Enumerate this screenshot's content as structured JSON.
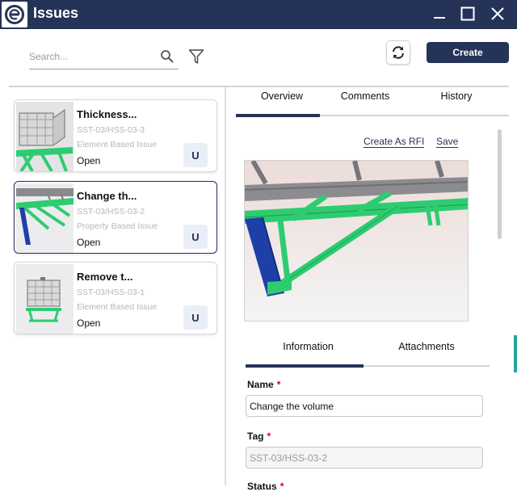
{
  "window": {
    "title": "Issues"
  },
  "search": {
    "placeholder": "Search..."
  },
  "toolbar": {
    "create_label": "Create"
  },
  "issues": [
    {
      "title": "Thickness...",
      "tag": "SST-03/HSS-03-3",
      "type": "Element Based Issue",
      "status": "Open",
      "assignee": "U"
    },
    {
      "title": "Change th...",
      "tag": "SST-03/HSS-03-2",
      "type": "Property Based Issue",
      "status": "Open",
      "assignee": "U"
    },
    {
      "title": "Remove t...",
      "tag": "SST-03/HSS-03-1",
      "type": "Element Based Issue",
      "status": "Open",
      "assignee": "U"
    }
  ],
  "detail_tabs": [
    "Overview",
    "Comments",
    "History"
  ],
  "actions": {
    "create_rfi": "Create As RFI",
    "save": "Save"
  },
  "sub_tabs": [
    "Information",
    "Attachments"
  ],
  "form": {
    "name_label": "Name",
    "name_value": "Change the volume",
    "tag_label": "Tag",
    "tag_value": "SST-03/HSS-03-2",
    "status_label": "Status",
    "required_mark": "*"
  },
  "colors": {
    "brand": "#253358",
    "accent_green": "#2ecc71",
    "steel_blue": "#1f3fa8"
  }
}
